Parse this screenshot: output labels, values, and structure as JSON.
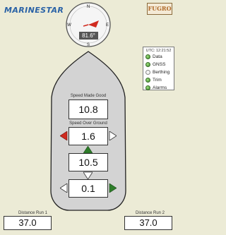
{
  "brand": {
    "logo": "MARINESTAR",
    "partner_logo": "FUGRO"
  },
  "compass": {
    "north": "N",
    "east": "E",
    "south": "S",
    "west": "W",
    "heading": "81.6°"
  },
  "status_panel": {
    "utc": "UTC: 12:21:52",
    "items": [
      {
        "label": "Data",
        "state": "on"
      },
      {
        "label": "GNSS",
        "state": "on"
      },
      {
        "label": "Berthing",
        "state": "off"
      },
      {
        "label": "Trim",
        "state": "on"
      },
      {
        "label": "Alarms",
        "state": "on"
      }
    ]
  },
  "ship": {
    "smg_label": "Speed Made Good",
    "smg_value": "10.8",
    "sog_label": "Speed Over Ground",
    "sog_value": "1.6",
    "value3": "10.5",
    "value4": "0.1"
  },
  "distance": {
    "run1_label": "Distance Run 1",
    "run1_value": "37.0",
    "run2_label": "Distance Run 2",
    "run2_value": "37.0"
  },
  "colors": {
    "accent_red": "#d02a1f",
    "accent_green": "#2e7d2a",
    "brand_blue": "#2a62a6"
  }
}
